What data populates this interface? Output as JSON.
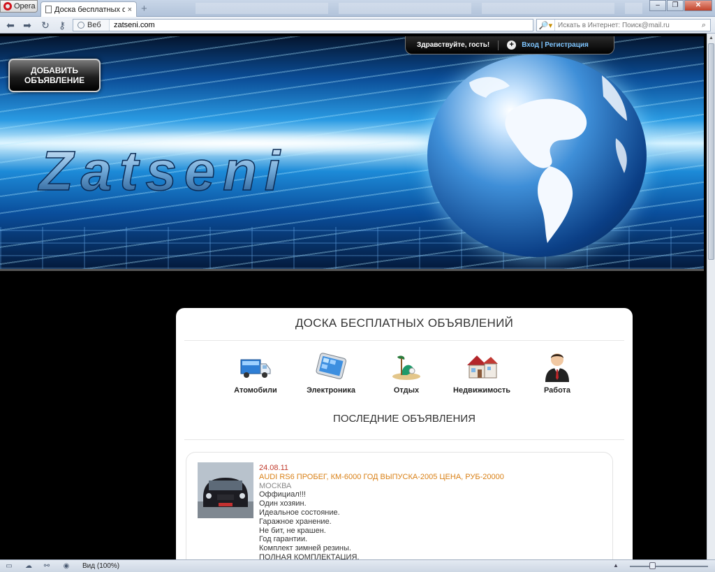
{
  "browser": {
    "menu_label": "Opera",
    "tab_title": "Доска бесплатных об...",
    "tab_close": "×",
    "new_tab": "+",
    "window_controls": [
      "–",
      "❐",
      "✕"
    ],
    "address_scheme": "Веб",
    "url": "zatseni.com",
    "search_placeholder": "Искать в Интернет: Поиск@mail.ru",
    "status_zoom": "Вид (100%)"
  },
  "header": {
    "add_button": "ДОБАВИТЬ ОБЪЯВЛЕНИЕ",
    "greeting": "Здравствуйте, гость!",
    "login_links": "Вход | Регистрация",
    "logo_text": "Zatseni"
  },
  "main": {
    "title": "ДОСКА БЕСПЛАТНЫХ ОБЪЯВЛЕНИЙ",
    "categories": [
      {
        "label": "Атомобили",
        "icon": "truck-icon"
      },
      {
        "label": "Электроника",
        "icon": "tablet-icon"
      },
      {
        "label": "Отдых",
        "icon": "beach-icon"
      },
      {
        "label": "Недвижимость",
        "icon": "house-icon"
      },
      {
        "label": "Работа",
        "icon": "businessman-icon"
      }
    ],
    "latest_title": "ПОСЛЕДНИЕ ОБЪЯВЛЕНИЯ",
    "ads": [
      {
        "date": "24.08.11",
        "title": "AUDI RS6 ПРОБЕГ, КМ-6000 ГОД ВЫПУСКА-2005 ЦЕНА, РУБ-20000",
        "city": "МОСКВА",
        "lines": [
          "Оффициал!!!",
          "Один хозяин.",
          "Идеальное состояние.",
          "Гаражное хранение.",
          "Не бит, не крашен.",
          "Год гарантии.",
          "Комплект зимней резины.",
          "ПОЛНАЯ КОМПЛЕКТАЦИЯ."
        ]
      }
    ]
  },
  "colors": {
    "ad_date": "#c0392b",
    "ad_title": "#d98016",
    "links": "#7ec5ff"
  }
}
